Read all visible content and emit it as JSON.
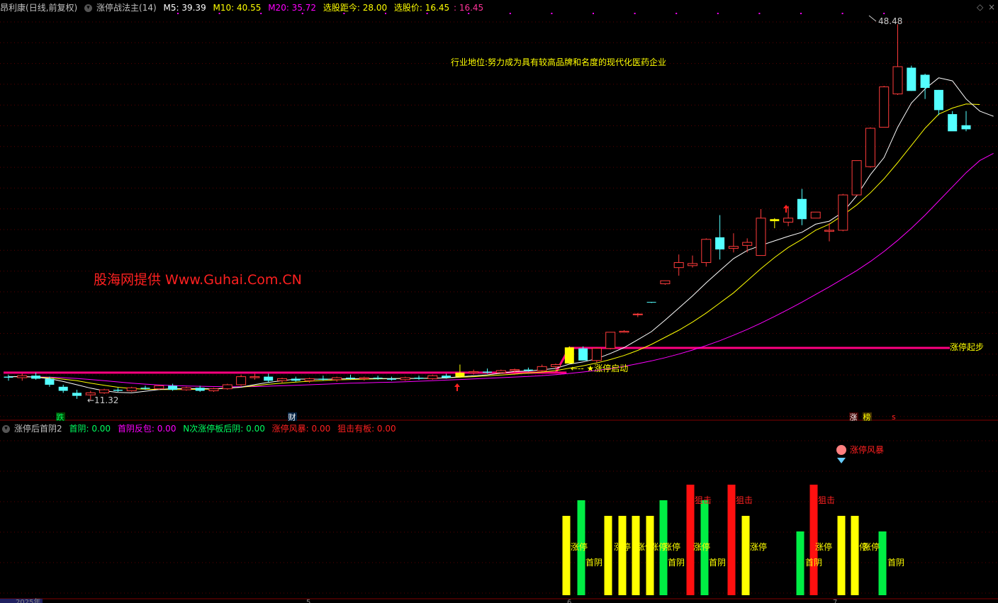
{
  "header": {
    "stock": "昂利康",
    "mode": "(日线,前复权)",
    "indicator": "涨停战法主(14)",
    "m5": "M5: 39.39",
    "m10": "M10: 40.55",
    "m20": "M20: 35.72",
    "dist": "选股距今: 28.00",
    "price": "选股价: 16.45",
    "price2": ": 16.45"
  },
  "sub_header": {
    "title": "涨停后首阴2",
    "v1": "首阴: 0.00",
    "v2": "首阴反包: 0.00",
    "v3": "N次涨停板后阴: 0.00",
    "v4": "涨停风暴: 0.00",
    "v5": "狙击有板: 0.00"
  },
  "annotations": {
    "industry": "行业地位:努力成为具有较高品牌和名度的现代化医药企业",
    "watermark": "股海网提供 Www.Guhai.Com.CN",
    "high": "48.48",
    "low": "←11.32",
    "zt_start": "涨停起步",
    "zt_launch": "←-- ★涨停启动",
    "mark_fall": "跌",
    "mark_cai": "财",
    "mark_zhang": "涨",
    "mark_bang": "榜",
    "mark_s": "s",
    "storm": "涨停风暴",
    "year": "2025年",
    "month5": "5",
    "month6": "6",
    "month7": "7",
    "bar_zt": "涨停",
    "bar_sy": "首阴",
    "bar_jj": "狙击"
  },
  "chart_data": {
    "type": "candlestick",
    "price_range": [
      9.5,
      49.5
    ],
    "series": {
      "candles": [
        {
          "o": 13.6,
          "h": 13.8,
          "l": 13.2,
          "c": 13.5
        },
        {
          "o": 13.5,
          "h": 13.9,
          "l": 13.2,
          "c": 13.7
        },
        {
          "o": 13.7,
          "h": 14.0,
          "l": 13.3,
          "c": 13.4
        },
        {
          "o": 13.4,
          "h": 13.6,
          "l": 12.6,
          "c": 12.8
        },
        {
          "o": 12.6,
          "h": 12.8,
          "l": 12.0,
          "c": 12.2
        },
        {
          "o": 12.0,
          "h": 12.3,
          "l": 11.4,
          "c": 11.7
        },
        {
          "o": 11.8,
          "h": 12.2,
          "l": 11.3,
          "c": 12.0
        },
        {
          "o": 12.0,
          "h": 12.4,
          "l": 11.9,
          "c": 12.3
        },
        {
          "o": 12.3,
          "h": 12.5,
          "l": 12.1,
          "c": 12.2
        },
        {
          "o": 12.2,
          "h": 12.6,
          "l": 12.1,
          "c": 12.5
        },
        {
          "o": 12.5,
          "h": 12.7,
          "l": 12.3,
          "c": 12.4
        },
        {
          "o": 12.4,
          "h": 12.8,
          "l": 12.3,
          "c": 12.7
        },
        {
          "o": 12.7,
          "h": 12.9,
          "l": 12.2,
          "c": 12.3
        },
        {
          "o": 12.3,
          "h": 12.6,
          "l": 12.2,
          "c": 12.5
        },
        {
          "o": 12.5,
          "h": 12.7,
          "l": 12.1,
          "c": 12.2
        },
        {
          "o": 12.2,
          "h": 12.5,
          "l": 12.1,
          "c": 12.4
        },
        {
          "o": 12.4,
          "h": 12.9,
          "l": 12.3,
          "c": 12.8
        },
        {
          "o": 12.8,
          "h": 13.8,
          "l": 12.7,
          "c": 13.6
        },
        {
          "o": 13.5,
          "h": 13.9,
          "l": 13.3,
          "c": 13.6
        },
        {
          "o": 13.6,
          "h": 13.9,
          "l": 13.0,
          "c": 13.2
        },
        {
          "o": 13.2,
          "h": 13.5,
          "l": 13.0,
          "c": 13.4
        },
        {
          "o": 13.4,
          "h": 13.6,
          "l": 13.1,
          "c": 13.2
        },
        {
          "o": 13.2,
          "h": 13.5,
          "l": 13.0,
          "c": 13.4
        },
        {
          "o": 13.4,
          "h": 13.7,
          "l": 13.2,
          "c": 13.3
        },
        {
          "o": 13.3,
          "h": 13.6,
          "l": 13.1,
          "c": 13.5
        },
        {
          "o": 13.5,
          "h": 13.8,
          "l": 13.3,
          "c": 13.4
        },
        {
          "o": 13.4,
          "h": 13.6,
          "l": 13.2,
          "c": 13.5
        },
        {
          "o": 13.5,
          "h": 13.7,
          "l": 13.3,
          "c": 13.4
        },
        {
          "o": 13.4,
          "h": 13.6,
          "l": 13.2,
          "c": 13.3
        },
        {
          "o": 13.3,
          "h": 13.6,
          "l": 13.2,
          "c": 13.5
        },
        {
          "o": 13.5,
          "h": 13.7,
          "l": 13.3,
          "c": 13.4
        },
        {
          "o": 13.4,
          "h": 13.8,
          "l": 13.3,
          "c": 13.7
        },
        {
          "o": 13.7,
          "h": 13.9,
          "l": 13.4,
          "c": 13.5
        },
        {
          "o": 13.6,
          "h": 14.8,
          "l": 13.5,
          "c": 14.0
        },
        {
          "o": 14.0,
          "h": 14.3,
          "l": 13.8,
          "c": 14.1
        },
        {
          "o": 14.1,
          "h": 14.4,
          "l": 13.9,
          "c": 14.0
        },
        {
          "o": 14.0,
          "h": 14.3,
          "l": 13.9,
          "c": 14.2
        },
        {
          "o": 14.2,
          "h": 14.4,
          "l": 14.0,
          "c": 14.3
        },
        {
          "o": 14.3,
          "h": 14.5,
          "l": 14.1,
          "c": 14.2
        },
        {
          "o": 14.2,
          "h": 14.8,
          "l": 14.1,
          "c": 14.6
        },
        {
          "o": 14.6,
          "h": 14.9,
          "l": 14.3,
          "c": 14.8
        },
        {
          "o": 14.9,
          "h": 16.6,
          "l": 14.9,
          "c": 16.5
        },
        {
          "o": 16.4,
          "h": 16.6,
          "l": 15.2,
          "c": 15.2
        },
        {
          "o": 15.2,
          "h": 16.5,
          "l": 15.0,
          "c": 16.4
        },
        {
          "o": 16.4,
          "h": 18.0,
          "l": 16.3,
          "c": 18.0
        },
        {
          "o": 18.0,
          "h": 18.2,
          "l": 18.0,
          "c": 18.1
        },
        {
          "o": 19.8,
          "h": 19.9,
          "l": 19.5,
          "c": 19.8
        },
        {
          "o": 21.0,
          "h": 21.0,
          "l": 20.9,
          "c": 20.95
        },
        {
          "o": 22.8,
          "h": 23.1,
          "l": 22.7,
          "c": 23.1
        },
        {
          "o": 24.4,
          "h": 25.7,
          "l": 23.6,
          "c": 24.9
        },
        {
          "o": 24.6,
          "h": 25.6,
          "l": 24.4,
          "c": 24.8
        },
        {
          "o": 24.9,
          "h": 27.3,
          "l": 24.5,
          "c": 27.2
        },
        {
          "o": 27.4,
          "h": 29.6,
          "l": 25.2,
          "c": 26.2
        },
        {
          "o": 26.3,
          "h": 27.8,
          "l": 25.9,
          "c": 26.5
        },
        {
          "o": 26.6,
          "h": 27.3,
          "l": 25.9,
          "c": 26.9
        },
        {
          "o": 25.6,
          "h": 30.2,
          "l": 25.6,
          "c": 29.3
        },
        {
          "o": 29.0,
          "h": 29.3,
          "l": 28.3,
          "c": 29.2
        },
        {
          "o": 28.9,
          "h": 30.5,
          "l": 28.5,
          "c": 29.3
        },
        {
          "o": 31.2,
          "h": 32.2,
          "l": 28.6,
          "c": 29.2
        },
        {
          "o": 29.3,
          "h": 29.8,
          "l": 29.3,
          "c": 29.9
        },
        {
          "o": 28.0,
          "h": 28.8,
          "l": 27.0,
          "c": 28.1
        },
        {
          "o": 28.1,
          "h": 31.7,
          "l": 28.0,
          "c": 31.6
        },
        {
          "o": 31.6,
          "h": 35.0,
          "l": 31.5,
          "c": 35.0
        },
        {
          "o": 34.4,
          "h": 38.3,
          "l": 34.3,
          "c": 38.2
        },
        {
          "o": 38.3,
          "h": 42.4,
          "l": 38.3,
          "c": 42.3
        },
        {
          "o": 41.6,
          "h": 48.5,
          "l": 41.5,
          "c": 44.3
        },
        {
          "o": 44.2,
          "h": 44.4,
          "l": 41.9,
          "c": 41.9
        },
        {
          "o": 43.5,
          "h": 43.6,
          "l": 41.1,
          "c": 42.2
        },
        {
          "o": 42.0,
          "h": 42.0,
          "l": 39.5,
          "c": 40.0
        },
        {
          "o": 39.6,
          "h": 39.9,
          "l": 38.0,
          "c": 37.9
        },
        {
          "o": 38.5,
          "h": 39.9,
          "l": 37.9,
          "c": 38.1
        }
      ],
      "m5": [
        13.6,
        13.62,
        13.54,
        13.4,
        13.12,
        12.8,
        12.46,
        12.2,
        12.04,
        12.0,
        12.16,
        12.33,
        12.42,
        12.42,
        12.42,
        12.4,
        12.46,
        12.56,
        12.82,
        13.04,
        13.2,
        13.36,
        13.36,
        13.34,
        13.37,
        13.4,
        13.41,
        13.42,
        13.41,
        13.42,
        13.42,
        13.45,
        13.47,
        13.6,
        13.68,
        13.78,
        13.94,
        14.12,
        14.16,
        14.28,
        14.42,
        14.84,
        15.06,
        15.38,
        15.9,
        16.48,
        17.26,
        18.06,
        19.2,
        20.4,
        21.6,
        22.9,
        24.1,
        25.3,
        26.1,
        26.6,
        27.05,
        27.5,
        27.9,
        28.7,
        29.0,
        29.9,
        31.5,
        33.6,
        35.3,
        38.3,
        40.7,
        42.1,
        43.2,
        42.9,
        41.1,
        39.9,
        39.39
      ],
      "m10": [
        13.6,
        13.6,
        13.55,
        13.5,
        13.35,
        13.2,
        12.95,
        12.75,
        12.55,
        12.42,
        12.36,
        12.32,
        12.32,
        12.32,
        12.35,
        12.38,
        12.45,
        12.55,
        12.7,
        12.85,
        12.95,
        13.06,
        13.15,
        13.22,
        13.28,
        13.32,
        13.36,
        13.38,
        13.4,
        13.42,
        13.43,
        13.45,
        13.48,
        13.54,
        13.6,
        13.68,
        13.76,
        13.85,
        13.96,
        14.06,
        14.2,
        14.44,
        14.68,
        14.95,
        15.3,
        15.7,
        16.2,
        16.8,
        17.5,
        18.2,
        19.0,
        19.9,
        20.9,
        21.9,
        23.1,
        24.3,
        25.4,
        26.4,
        27.2,
        28.1,
        28.7,
        29.6,
        30.6,
        31.8,
        33.2,
        34.8,
        36.5,
        38.2,
        39.6,
        40.2,
        40.6,
        40.55
      ],
      "m20": [
        13.6,
        13.6,
        13.58,
        13.55,
        13.5,
        13.42,
        13.32,
        13.2,
        13.08,
        12.96,
        12.86,
        12.78,
        12.72,
        12.68,
        12.65,
        12.62,
        12.6,
        12.6,
        12.62,
        12.66,
        12.7,
        12.75,
        12.8,
        12.85,
        12.9,
        12.95,
        12.98,
        13.02,
        13.05,
        13.1,
        13.15,
        13.2,
        13.26,
        13.32,
        13.38,
        13.44,
        13.5,
        13.56,
        13.62,
        13.7,
        13.8,
        13.92,
        14.06,
        14.22,
        14.4,
        14.62,
        14.88,
        15.16,
        15.48,
        15.84,
        16.24,
        16.68,
        17.16,
        17.7,
        18.28,
        18.9,
        19.56,
        20.26,
        20.98,
        21.74,
        22.5,
        23.3,
        24.1,
        25.0,
        26.0,
        27.1,
        28.3,
        29.6,
        31.0,
        32.4,
        33.8,
        35.0,
        35.72
      ],
      "zt_base_line": 14.0,
      "zt_start_line": 16.45,
      "sub_bars": [
        {
          "x": 799,
          "color": "yellow",
          "top": 728
        },
        {
          "x": 820,
          "color": "green",
          "top": 706
        },
        {
          "x": 858,
          "color": "yellow",
          "top": 728
        },
        {
          "x": 878,
          "color": "yellow",
          "top": 728
        },
        {
          "x": 897,
          "color": "yellow",
          "top": 728
        },
        {
          "x": 917,
          "color": "yellow",
          "top": 728
        },
        {
          "x": 936,
          "color": "green",
          "top": 706
        },
        {
          "x": 974,
          "color": "red",
          "top": 684
        },
        {
          "x": 994,
          "color": "green",
          "top": 706
        },
        {
          "x": 1032,
          "color": "red",
          "top": 684
        },
        {
          "x": 1052,
          "color": "yellow",
          "top": 728
        },
        {
          "x": 1129,
          "color": "green",
          "top": 750
        },
        {
          "x": 1148,
          "color": "red",
          "top": 684
        },
        {
          "x": 1187,
          "color": "yellow",
          "top": 728
        },
        {
          "x": 1206,
          "color": "yellow",
          "top": 728
        },
        {
          "x": 1245,
          "color": "green",
          "top": 750
        }
      ]
    },
    "colors": {
      "up": "#ff3b3b",
      "down": "#54ffff",
      "m5": "#ffffff",
      "m10": "#ffff00",
      "m20": "#ff00ff",
      "line": "#ff0080",
      "text_yellow": "#ffff00",
      "text_red": "#ff2020"
    }
  }
}
